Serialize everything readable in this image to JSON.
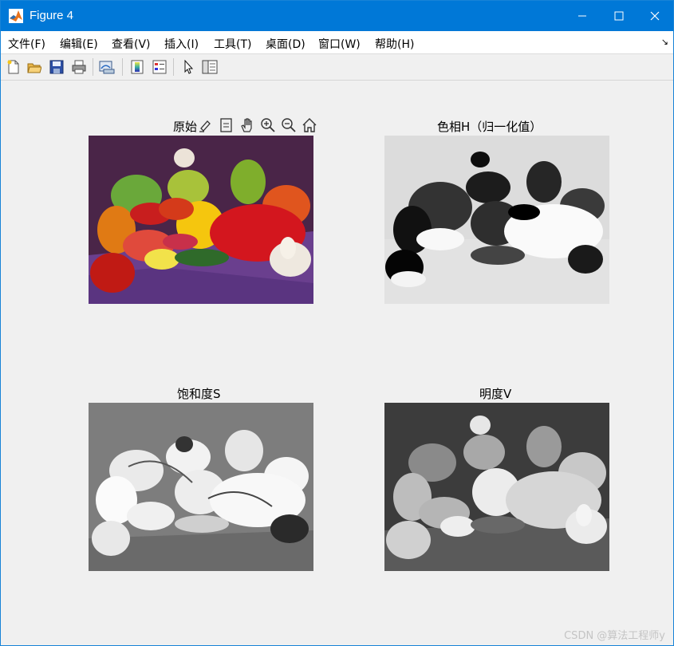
{
  "window": {
    "title": "Figure 4",
    "accent_color": "#0078d7"
  },
  "menu": {
    "items": [
      {
        "label": "文件(F)"
      },
      {
        "label": "编辑(E)"
      },
      {
        "label": "查看(V)"
      },
      {
        "label": "插入(I)"
      },
      {
        "label": "工具(T)"
      },
      {
        "label": "桌面(D)"
      },
      {
        "label": "窗口(W)"
      },
      {
        "label": "帮助(H)"
      }
    ]
  },
  "toolbar": {
    "icons": [
      "new-figure-icon",
      "open-file-icon",
      "save-icon",
      "print-icon",
      "link-plot-icon",
      "insert-colorbar-icon",
      "insert-legend-icon",
      "edit-plot-pointer-icon",
      "property-inspector-icon"
    ]
  },
  "axes_toolbar": {
    "icons": [
      "brush-icon",
      "data-tips-icon",
      "pan-hand-icon",
      "zoom-in-icon",
      "zoom-out-icon",
      "restore-view-home-icon"
    ]
  },
  "subplots": [
    {
      "title": "原始",
      "content": "color photo of peppers and garlic"
    },
    {
      "title": "色相H（归一化值）",
      "content": "grayscale hue channel"
    },
    {
      "title": "饱和度S",
      "content": "grayscale saturation channel"
    },
    {
      "title": "明度V",
      "content": "grayscale value channel"
    }
  ],
  "watermark": "CSDN @算法工程师y"
}
